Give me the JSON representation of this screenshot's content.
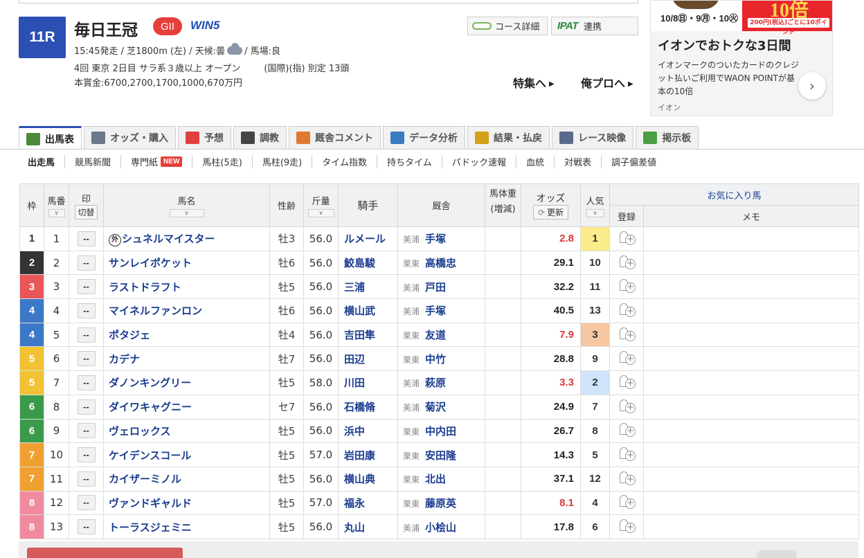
{
  "race": {
    "number": "11R",
    "title": "毎日王冠",
    "grade": "GII",
    "win5": "WIN5",
    "info_line1": "15:45発走 / 芝1800m (左) / 天候:曇",
    "info_line1_tail": "/ 馬場:良",
    "info_line2a": "4回 東京 2日目 サラ系３歳以上 オープン",
    "info_line2b": "(国際)(指) 別定 13頭",
    "prize": "本賞金:6700,2700,1700,1000,670万円"
  },
  "header_buttons": {
    "course": "コース詳細",
    "ipat_logo": "IPAT",
    "ipat": "連携",
    "feature": "特集へ",
    "pro": "俺プロへ"
  },
  "ad": {
    "dates": "10/8㊐・9㊊・10㊋",
    "big": "10倍",
    "pill": "200円(税込)ごとに10ポイント",
    "title": "イオンでおトクな3日間",
    "body": "イオンマークのついたカードのクレジット払いご利用でWAON POINTが基本の10倍",
    "brand": "イオン"
  },
  "tabs": [
    {
      "label": "出馬表",
      "color": "#4a8a3a"
    },
    {
      "label": "オッズ・購入",
      "color": "#6a7a8a"
    },
    {
      "label": "予想",
      "color": "#e04040"
    },
    {
      "label": "調教",
      "color": "#444444"
    },
    {
      "label": "厩舎コメント",
      "color": "#e07a30"
    },
    {
      "label": "データ分析",
      "color": "#3a7ac0"
    },
    {
      "label": "結果・払戻",
      "color": "#d4a017"
    },
    {
      "label": "レース映像",
      "color": "#5a6a8a"
    },
    {
      "label": "掲示板",
      "color": "#4aa040"
    }
  ],
  "subnav": [
    "出走馬",
    "競馬新聞",
    "専門紙",
    "馬柱(5走)",
    "馬柱(9走)",
    "タイム指数",
    "持ちタイム",
    "パドック速報",
    "血統",
    "対戦表",
    "調子偏差値"
  ],
  "subnav_new": "NEW",
  "headers": {
    "waku": "枠",
    "umaban": "馬番",
    "mark": "印",
    "mark_toggle": "切替",
    "name": "馬名",
    "sexage": "性齢",
    "weight": "斤量",
    "jockey": "騎手",
    "trainer": "厩舎",
    "body_weight": "馬体重",
    "body_weight_sub": "(増減)",
    "odds": "オッズ",
    "update": "更新",
    "pop": "人気",
    "fav": "お気に入り馬",
    "register": "登録",
    "memo": "メモ",
    "sort": "∨"
  },
  "horses": [
    {
      "waku": "1",
      "umaban": "1",
      "mark": "--",
      "gai": "外",
      "name": "シュネルマイスター",
      "sexage": "牡3",
      "weight": "56.0",
      "jockey": "ルメール",
      "region": "美浦",
      "trainer": "手塚",
      "odds": "2.8",
      "hot": true,
      "pop": "1"
    },
    {
      "waku": "2",
      "umaban": "2",
      "mark": "--",
      "gai": "",
      "name": "サンレイポケット",
      "sexage": "牡6",
      "weight": "56.0",
      "jockey": "鮫島駿",
      "region": "栗東",
      "trainer": "高橋忠",
      "odds": "29.1",
      "hot": false,
      "pop": "10"
    },
    {
      "waku": "3",
      "umaban": "3",
      "mark": "--",
      "gai": "",
      "name": "ラストドラフト",
      "sexage": "牡5",
      "weight": "56.0",
      "jockey": "三浦",
      "region": "美浦",
      "trainer": "戸田",
      "odds": "32.2",
      "hot": false,
      "pop": "11"
    },
    {
      "waku": "4",
      "umaban": "4",
      "mark": "--",
      "gai": "",
      "name": "マイネルファンロン",
      "sexage": "牡6",
      "weight": "56.0",
      "jockey": "横山武",
      "region": "美浦",
      "trainer": "手塚",
      "odds": "40.5",
      "hot": false,
      "pop": "13"
    },
    {
      "waku": "4",
      "umaban": "5",
      "mark": "--",
      "gai": "",
      "name": "ポタジェ",
      "sexage": "牡4",
      "weight": "56.0",
      "jockey": "吉田隼",
      "region": "栗東",
      "trainer": "友道",
      "odds": "7.9",
      "hot": true,
      "pop": "3"
    },
    {
      "waku": "5",
      "umaban": "6",
      "mark": "--",
      "gai": "",
      "name": "カデナ",
      "sexage": "牡7",
      "weight": "56.0",
      "jockey": "田辺",
      "region": "栗東",
      "trainer": "中竹",
      "odds": "28.8",
      "hot": false,
      "pop": "9"
    },
    {
      "waku": "5",
      "umaban": "7",
      "mark": "--",
      "gai": "",
      "name": "ダノンキングリー",
      "sexage": "牡5",
      "weight": "58.0",
      "jockey": "川田",
      "region": "美浦",
      "trainer": "萩原",
      "odds": "3.3",
      "hot": true,
      "pop": "2"
    },
    {
      "waku": "6",
      "umaban": "8",
      "mark": "--",
      "gai": "",
      "name": "ダイワキャグニー",
      "sexage": "セ7",
      "weight": "56.0",
      "jockey": "石橋脩",
      "region": "美浦",
      "trainer": "菊沢",
      "odds": "24.9",
      "hot": false,
      "pop": "7"
    },
    {
      "waku": "6",
      "umaban": "9",
      "mark": "--",
      "gai": "",
      "name": "ヴェロックス",
      "sexage": "牡5",
      "weight": "56.0",
      "jockey": "浜中",
      "region": "栗東",
      "trainer": "中内田",
      "odds": "26.7",
      "hot": false,
      "pop": "8"
    },
    {
      "waku": "7",
      "umaban": "10",
      "mark": "--",
      "gai": "",
      "name": "ケイデンスコール",
      "sexage": "牡5",
      "weight": "57.0",
      "jockey": "岩田康",
      "region": "栗東",
      "trainer": "安田隆",
      "odds": "14.3",
      "hot": false,
      "pop": "5"
    },
    {
      "waku": "7",
      "umaban": "11",
      "mark": "--",
      "gai": "",
      "name": "カイザーミノル",
      "sexage": "牡5",
      "weight": "56.0",
      "jockey": "横山典",
      "region": "栗東",
      "trainer": "北出",
      "odds": "37.1",
      "hot": false,
      "pop": "12"
    },
    {
      "waku": "8",
      "umaban": "12",
      "mark": "--",
      "gai": "",
      "name": "ヴァンドギャルド",
      "sexage": "牡5",
      "weight": "57.0",
      "jockey": "福永",
      "region": "栗東",
      "trainer": "藤原英",
      "odds": "8.1",
      "hot": true,
      "pop": "4"
    },
    {
      "waku": "8",
      "umaban": "13",
      "mark": "--",
      "gai": "",
      "name": "トーラスジェミニ",
      "sexage": "牡5",
      "weight": "56.0",
      "jockey": "丸山",
      "region": "美浦",
      "trainer": "小桧山",
      "odds": "17.8",
      "hot": false,
      "pop": "6"
    }
  ],
  "waku_colors": {
    "1": [
      "#ffffff",
      "#333333"
    ],
    "2": [
      "#333333",
      "#ffffff"
    ],
    "3": [
      "#e8565a",
      "#ffffff"
    ],
    "4": [
      "#3b78c8",
      "#ffffff"
    ],
    "5": [
      "#f2c233",
      "#ffffff"
    ],
    "6": [
      "#3a9a4a",
      "#ffffff"
    ],
    "7": [
      "#f0a030",
      "#ffffff"
    ],
    "8": [
      "#f08aa0",
      "#ffffff"
    ]
  },
  "pop_colors": {
    "1": "#fcec8c",
    "2": "#cfe3fa",
    "3": "#f6c7a0"
  }
}
